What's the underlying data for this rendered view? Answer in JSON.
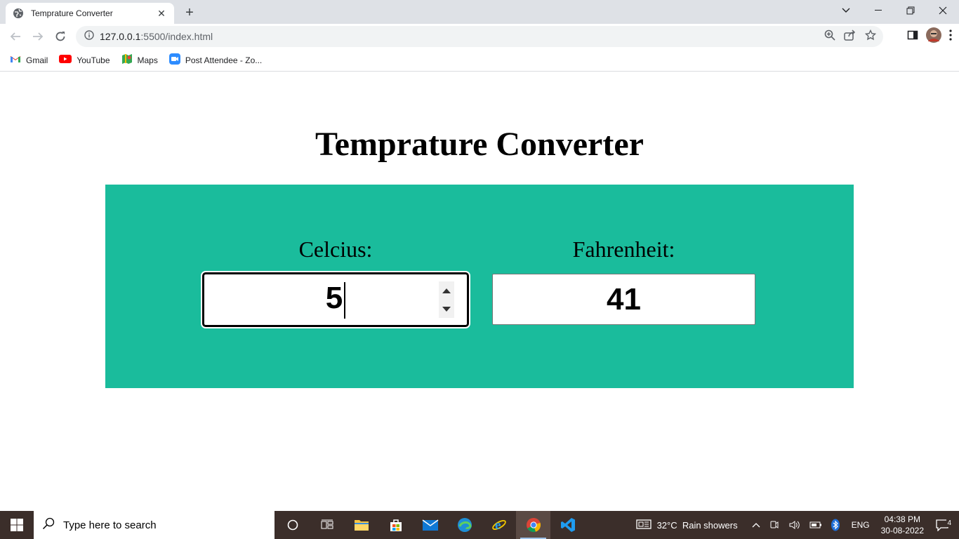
{
  "browser": {
    "tab_title": "Temprature Converter",
    "url_host": "127.0.0.1",
    "url_rest": ":5500/index.html",
    "bookmarks": [
      {
        "label": "Gmail"
      },
      {
        "label": "YouTube"
      },
      {
        "label": "Maps"
      },
      {
        "label": "Post Attendee - Zo..."
      }
    ]
  },
  "page": {
    "title": "Temprature Converter",
    "celsius_label": "Celcius:",
    "celsius_value": "5",
    "fahrenheit_label": "Fahrenheit:",
    "fahrenheit_value": "41"
  },
  "colors": {
    "panel": "#1abc9c"
  },
  "taskbar": {
    "search_placeholder": "Type here to search",
    "weather": "32°C  Rain showers",
    "language": "ENG",
    "time": "04:38 PM",
    "date": "30-08-2022",
    "notifications": "4"
  }
}
